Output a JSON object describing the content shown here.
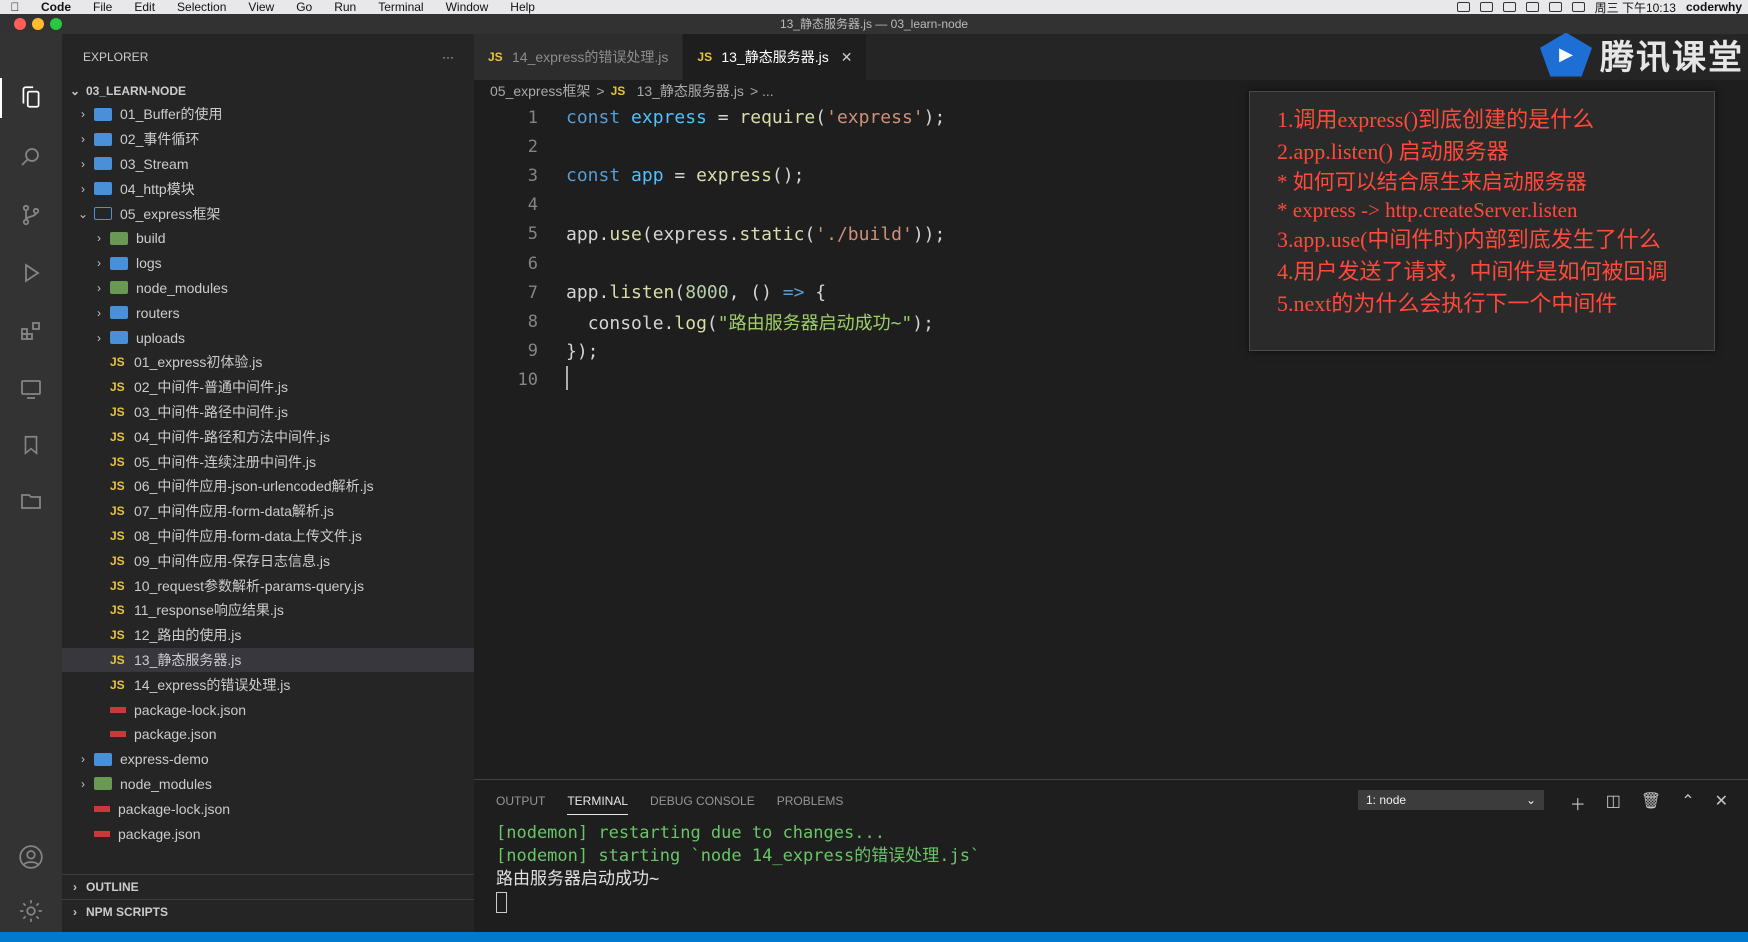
{
  "menubar": {
    "items": [
      "Code",
      "File",
      "Edit",
      "Selection",
      "View",
      "Go",
      "Run",
      "Terminal",
      "Window",
      "Help"
    ],
    "clock": "周三 下午10:13",
    "user": "coderwhy"
  },
  "window": {
    "title": "13_静态服务器.js — 03_learn-node"
  },
  "sidebar": {
    "header": "EXPLORER",
    "more": "···",
    "root": "03_LEARN-NODE",
    "items": [
      {
        "label": "01_Buffer的使用",
        "kind": "folder",
        "depth": 1,
        "expanded": false
      },
      {
        "label": "02_事件循环",
        "kind": "folder",
        "depth": 1,
        "expanded": false
      },
      {
        "label": "03_Stream",
        "kind": "folder",
        "depth": 1,
        "expanded": false
      },
      {
        "label": "04_http模块",
        "kind": "folder",
        "depth": 1,
        "expanded": false
      },
      {
        "label": "05_express框架",
        "kind": "folder-open",
        "depth": 1,
        "expanded": true
      },
      {
        "label": "build",
        "kind": "folder-special",
        "depth": 2,
        "expanded": false
      },
      {
        "label": "logs",
        "kind": "folder",
        "depth": 2,
        "expanded": false
      },
      {
        "label": "node_modules",
        "kind": "folder-special",
        "depth": 2,
        "expanded": false
      },
      {
        "label": "routers",
        "kind": "folder",
        "depth": 2,
        "expanded": false
      },
      {
        "label": "uploads",
        "kind": "folder",
        "depth": 2,
        "expanded": false
      },
      {
        "label": "01_express初体验.js",
        "kind": "js",
        "depth": 2
      },
      {
        "label": "02_中间件-普通中间件.js",
        "kind": "js",
        "depth": 2
      },
      {
        "label": "03_中间件-路径中间件.js",
        "kind": "js",
        "depth": 2
      },
      {
        "label": "04_中间件-路径和方法中间件.js",
        "kind": "js",
        "depth": 2
      },
      {
        "label": "05_中间件-连续注册中间件.js",
        "kind": "js",
        "depth": 2
      },
      {
        "label": "06_中间件应用-json-urlencoded解析.js",
        "kind": "js",
        "depth": 2
      },
      {
        "label": "07_中间件应用-form-data解析.js",
        "kind": "js",
        "depth": 2
      },
      {
        "label": "08_中间件应用-form-data上传文件.js",
        "kind": "js",
        "depth": 2
      },
      {
        "label": "09_中间件应用-保存日志信息.js",
        "kind": "js",
        "depth": 2
      },
      {
        "label": "10_request参数解析-params-query.js",
        "kind": "js",
        "depth": 2
      },
      {
        "label": "11_response响应结果.js",
        "kind": "js",
        "depth": 2
      },
      {
        "label": "12_路由的使用.js",
        "kind": "js",
        "depth": 2
      },
      {
        "label": "13_静态服务器.js",
        "kind": "js",
        "depth": 2,
        "selected": true
      },
      {
        "label": "14_express的错误处理.js",
        "kind": "js",
        "depth": 2
      },
      {
        "label": "package-lock.json",
        "kind": "npm",
        "depth": 2
      },
      {
        "label": "package.json",
        "kind": "npm",
        "depth": 2
      },
      {
        "label": "express-demo",
        "kind": "folder",
        "depth": 1,
        "expanded": false
      },
      {
        "label": "node_modules",
        "kind": "folder-special",
        "depth": 1,
        "expanded": false
      },
      {
        "label": "package-lock.json",
        "kind": "npm",
        "depth": 1
      },
      {
        "label": "package.json",
        "kind": "npm",
        "depth": 1
      }
    ],
    "outline": "OUTLINE",
    "npm_scripts": "NPM SCRIPTS"
  },
  "tabs": [
    {
      "label": "14_express的错误处理.js",
      "active": false
    },
    {
      "label": "13_静态服务器.js",
      "active": true,
      "close": "✕"
    }
  ],
  "breadcrumb": {
    "folder": "05_express框架",
    "sep": ">",
    "file": "13_静态服务器.js",
    "more": "> ..."
  },
  "editor": {
    "line_numbers": [
      "1",
      "2",
      "3",
      "4",
      "5",
      "6",
      "7",
      "8",
      "9",
      "10"
    ]
  },
  "note": {
    "lines": [
      "1.调用express()到底创建的是什么",
      "2.app.listen() 启动服务器",
      "* 如何可以结合原生来启动服务器",
      "* express -> http.createServer.listen",
      "3.app.use(中间件时)内部到底发生了什么",
      "4.用户发送了请求，中间件是如何被回调",
      "5.next的为什么会执行下一个中间件"
    ]
  },
  "logo": {
    "text": "腾讯课堂"
  },
  "panel": {
    "tabs": [
      "OUTPUT",
      "TERMINAL",
      "DEBUG CONSOLE",
      "PROBLEMS"
    ],
    "active_tab": "TERMINAL",
    "terminal_select": "1: node",
    "terminal_lines": [
      {
        "text": "[nodemon] restarting due to changes...",
        "color": "green"
      },
      {
        "text": "[nodemon] starting `node 14_express的错误处理.js`",
        "color": "green"
      },
      {
        "text": "路由服务器启动成功~",
        "color": "white"
      }
    ]
  },
  "colors": {
    "accent": "#007acc",
    "note_text": "#ff4a3a",
    "folder": "#4a90d9",
    "js_icon": "#e8c43b"
  }
}
